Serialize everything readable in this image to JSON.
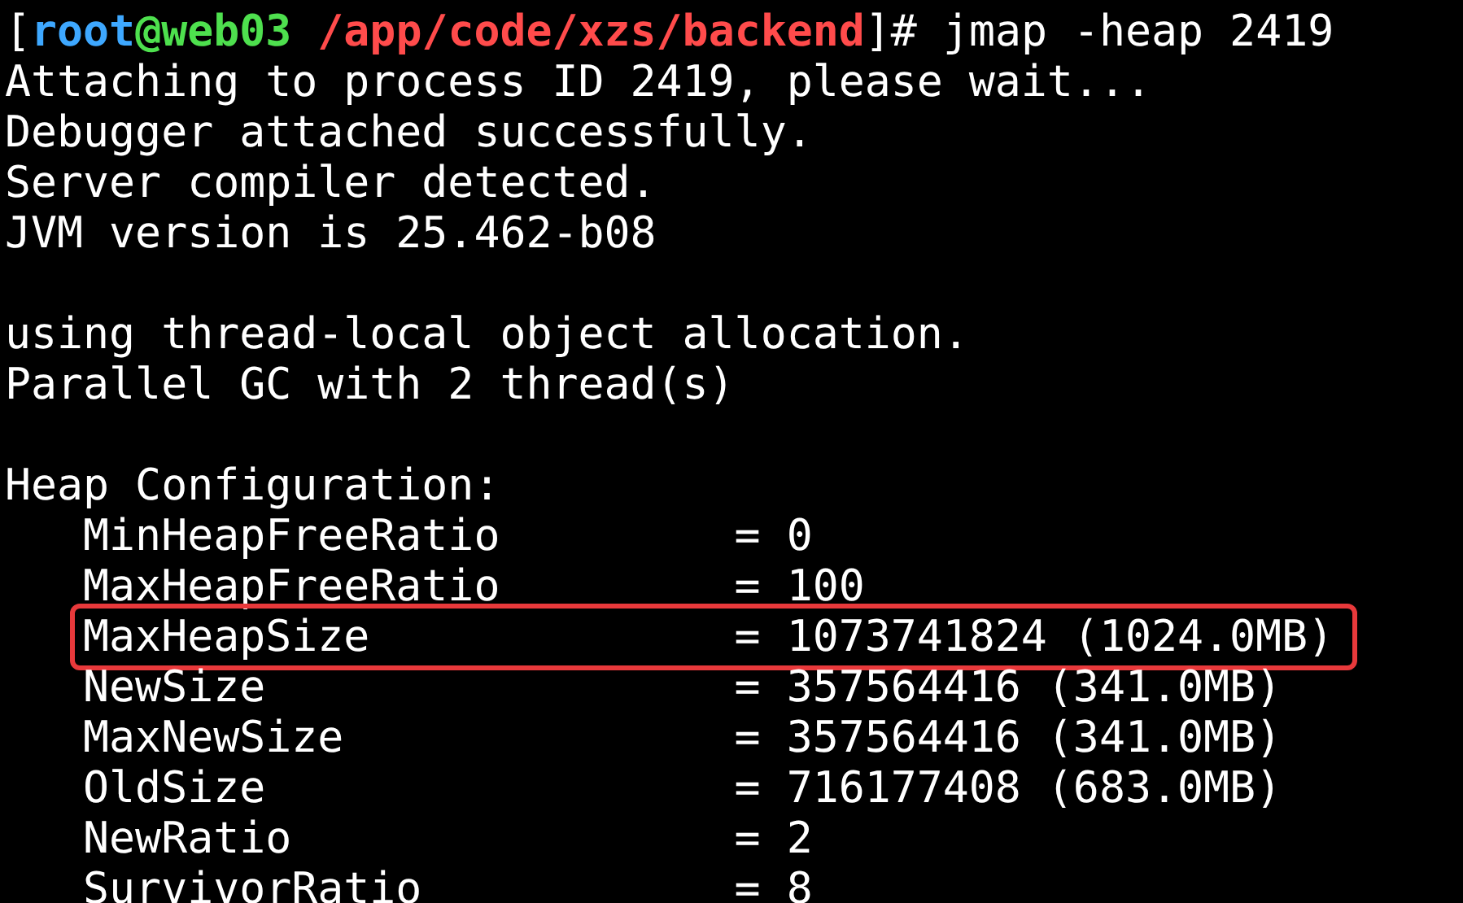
{
  "prompt": {
    "open": "[",
    "user": "root",
    "host": "@web03",
    "path": "/app/code/xzs/backend",
    "close": "]#",
    "command": "jmap -heap 2419"
  },
  "output_blocks": [
    {
      "lines": [
        "Attaching to process ID 2419, please wait...",
        "Debugger attached successfully.",
        "Server compiler detected.",
        "JVM version is 25.462-b08"
      ]
    },
    {
      "lines": [
        "using thread-local object allocation.",
        "Parallel GC with 2 thread(s)"
      ]
    }
  ],
  "heap_configuration": {
    "title": "Heap Configuration:",
    "rows": [
      {
        "name": "MinHeapFreeRatio",
        "sign": "=",
        "value": "0",
        "highlighted": false
      },
      {
        "name": "MaxHeapFreeRatio",
        "sign": "=",
        "value": "100",
        "highlighted": false
      },
      {
        "name": "MaxHeapSize",
        "sign": "=",
        "value": "1073741824 (1024.0MB)",
        "highlighted": true
      },
      {
        "name": "NewSize",
        "sign": "=",
        "value": "357564416 (341.0MB)",
        "highlighted": false
      },
      {
        "name": "MaxNewSize",
        "sign": "=",
        "value": "357564416 (341.0MB)",
        "highlighted": false
      },
      {
        "name": "OldSize",
        "sign": "=",
        "value": "716177408 (683.0MB)",
        "highlighted": false
      },
      {
        "name": "NewRatio",
        "sign": "=",
        "value": "2",
        "highlighted": false
      },
      {
        "name": "SurvivorRatio",
        "sign": "=",
        "value": "8",
        "highlighted": false
      }
    ]
  }
}
